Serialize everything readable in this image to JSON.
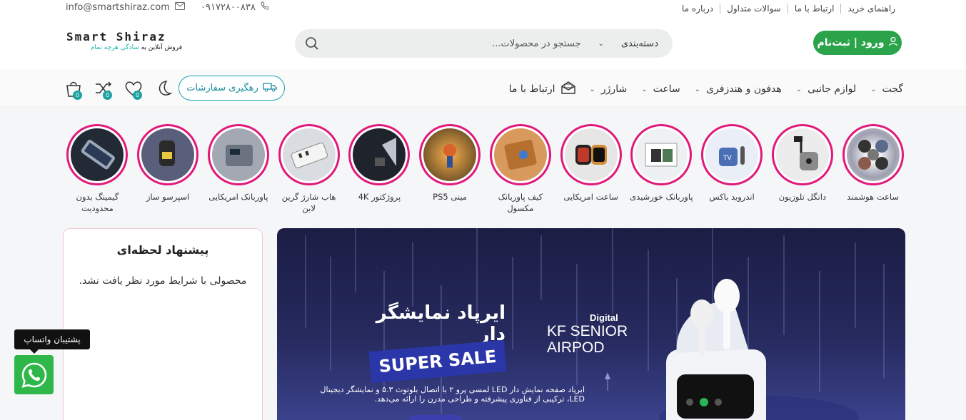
{
  "topbar": {
    "links": [
      "راهنمای خرید",
      "ارتباط با ما",
      "سوالات متداول",
      "درباره ما"
    ],
    "email": "info@smartshiraz.com",
    "phone": "۰۹۱۷۲۸۰۰۸۳۸"
  },
  "header": {
    "logo_line1": "Smart Shiraz",
    "logo_line2_a": "فروش آنلاین به",
    "logo_line2_b": "سادگی هرچه تمام",
    "search_category": "دسته‌بندی",
    "search_placeholder": "جستجو در محصولات...",
    "login_label": "ورود | ثبت‌نام"
  },
  "nav": {
    "items": [
      {
        "label": "گجت",
        "dropdown": true
      },
      {
        "label": "لوازم جانبی",
        "dropdown": true
      },
      {
        "label": "هدفون و هندزفری",
        "dropdown": true
      },
      {
        "label": "ساعت",
        "dropdown": true
      },
      {
        "label": "شارژر",
        "dropdown": true
      },
      {
        "label": "ارتباط با ما",
        "icon": "mail-open-icon"
      }
    ],
    "track_orders": "رهگیری سفارشات",
    "cart_count": "0",
    "compare_count": "0",
    "wishlist_count": "0"
  },
  "categories": [
    {
      "label": "ساعت هوشمند",
      "color": "#c9cbd6"
    },
    {
      "label": "دانگل تلوزیون",
      "color": "#e6e6e6"
    },
    {
      "label": "اندروید باکس",
      "color": "#dfe6f3"
    },
    {
      "label": "پاوربانک خورشیدی",
      "color": "#e4eaef"
    },
    {
      "label": "ساعت امریکایی",
      "color": "#d8d8d8"
    },
    {
      "label": "کیف پاوربانک مکسول",
      "color": "#c7884f"
    },
    {
      "label": "مینی PS5",
      "color": "#8e6b3f"
    },
    {
      "label": "پروژکتور 4K",
      "color": "#2a2f3a"
    },
    {
      "label": "هاب شارژ گرین لاین",
      "color": "#d7d9dd"
    },
    {
      "label": "پاوربانک امریکایی",
      "color": "#9ea3ad"
    },
    {
      "label": "اسپرسو ساز",
      "color": "#4a4e6a"
    },
    {
      "label": "گیمینگ بدون محدودیت",
      "color": "#27303d"
    }
  ],
  "offer": {
    "title": "پیشنهاد لحظه‌ای",
    "empty_message": "محصولی با شرایط مورد نظر یافت نشد."
  },
  "banner": {
    "title": "ایرپاد نمایشگر دار",
    "sale": "SUPER SALE",
    "brand_small": "Digital",
    "brand_line1": "KF SENIOR",
    "brand_line2": "AIRPOD",
    "description": "ایرپاد صفحه نمایش دار LED لمسی پرو ۲ با اتصال بلوتوث ۵.۳ و نمایشگر دیجیتال LED، ترکیبی از فناوری پیشرفته و طراحی مدرن را ارائه می‌دهد."
  },
  "whatsapp": {
    "tooltip": "پشتیبان واتساپ"
  }
}
